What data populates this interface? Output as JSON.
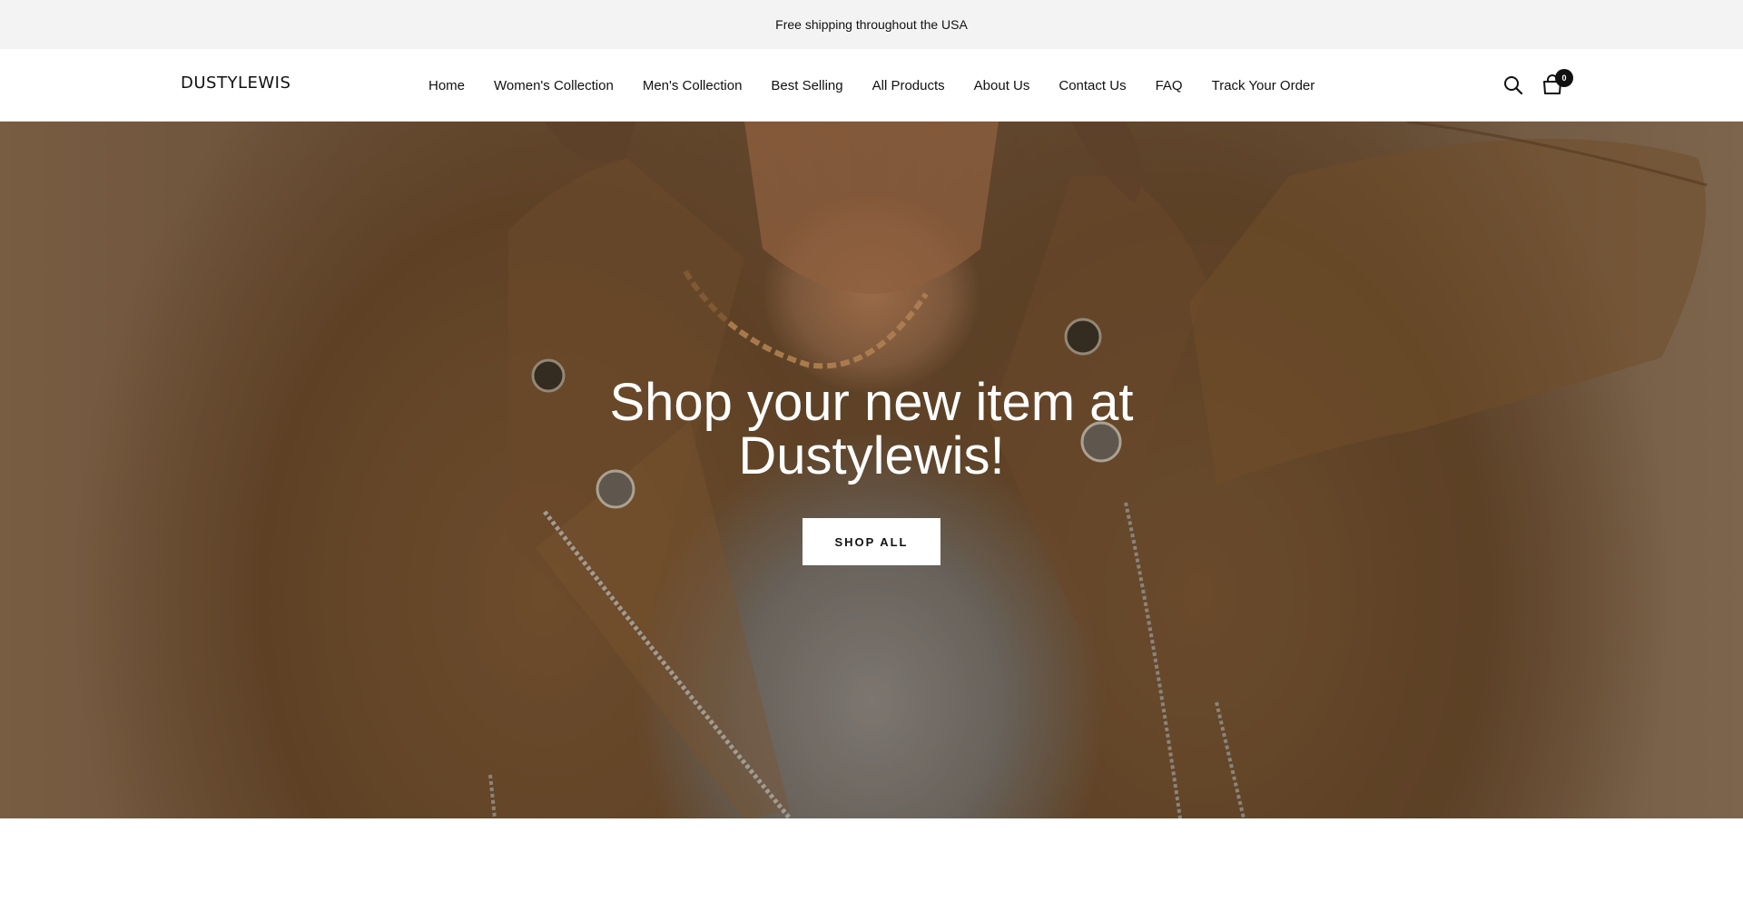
{
  "announcement": {
    "text": "Free shipping throughout the USA"
  },
  "header": {
    "logo": "DUSTYLEWIS",
    "nav": [
      {
        "label": "Home"
      },
      {
        "label": "Women's Collection"
      },
      {
        "label": "Men's Collection"
      },
      {
        "label": "Best Selling"
      },
      {
        "label": "All Products"
      },
      {
        "label": "About Us"
      },
      {
        "label": "Contact Us"
      },
      {
        "label": "FAQ"
      },
      {
        "label": "Track Your Order"
      }
    ],
    "search_icon": "search-icon",
    "cart_icon": "shopping-bag-icon",
    "cart_count": "0"
  },
  "hero": {
    "title": "Shop your new item at Dustylewis!",
    "button_label": "SHOP ALL"
  },
  "colors": {
    "announcement_bg": "#f3f3f3",
    "text": "#111111",
    "jacket_brown": "#7c5732",
    "button_bg": "#ffffff"
  }
}
